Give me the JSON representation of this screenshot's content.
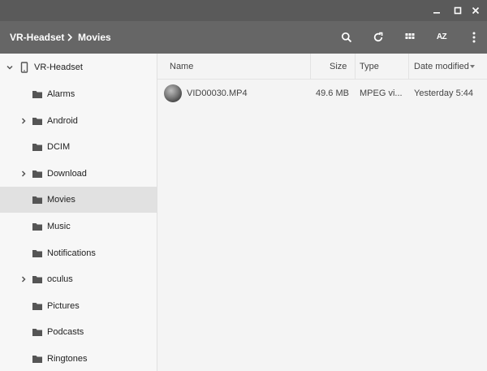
{
  "window": {
    "controls": [
      {
        "name": "minimize-icon"
      },
      {
        "name": "maximize-icon"
      },
      {
        "name": "close-icon"
      }
    ]
  },
  "breadcrumb": {
    "root": "VR-Headset",
    "current": "Movies",
    "separator_icon": "chevron-right-icon"
  },
  "toolbar": {
    "buttons": [
      "search-icon",
      "refresh-icon",
      "grid-view-icon",
      "sort-az-icon",
      "more-vert-icon"
    ],
    "sort_label": "AZ"
  },
  "sidebar": {
    "root": {
      "label": "VR-Headset",
      "icon": "phone-icon",
      "expanded": true
    },
    "items": [
      {
        "label": "Alarms",
        "icon": "folder-icon",
        "expandable": false
      },
      {
        "label": "Android",
        "icon": "folder-icon",
        "expandable": true
      },
      {
        "label": "DCIM",
        "icon": "folder-icon",
        "expandable": false
      },
      {
        "label": "Download",
        "icon": "folder-icon",
        "expandable": true
      },
      {
        "label": "Movies",
        "icon": "folder-icon",
        "expandable": false,
        "selected": true
      },
      {
        "label": "Music",
        "icon": "folder-icon",
        "expandable": false
      },
      {
        "label": "Notifications",
        "icon": "folder-icon",
        "expandable": false
      },
      {
        "label": "oculus",
        "icon": "folder-icon",
        "expandable": true
      },
      {
        "label": "Pictures",
        "icon": "folder-icon",
        "expandable": false
      },
      {
        "label": "Podcasts",
        "icon": "folder-icon",
        "expandable": false
      },
      {
        "label": "Ringtones",
        "icon": "folder-icon",
        "expandable": false
      }
    ]
  },
  "table": {
    "columns": {
      "name": "Name",
      "size": "Size",
      "type": "Type",
      "date": "Date modified"
    },
    "rows": [
      {
        "name": "VID00030.MP4",
        "size": "49.6 MB",
        "type": "MPEG vi...",
        "date": "Yesterday 5:44"
      }
    ]
  },
  "colors": {
    "titlebar": "#5a5a5a",
    "toolbar": "#666666",
    "sidebar_bg": "#f7f7f7",
    "selected_bg": "#e1e1e1",
    "main_bg": "#f4f4f4"
  }
}
